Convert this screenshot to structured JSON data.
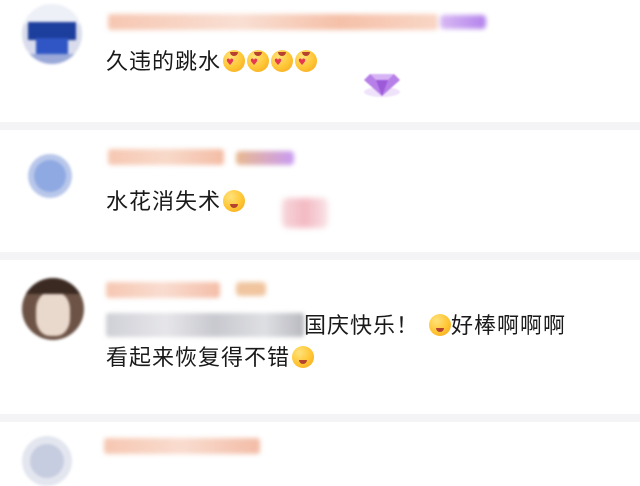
{
  "comments": [
    {
      "text_parts": [
        {
          "kind": "text",
          "value": "久违的跳水"
        },
        {
          "kind": "emoji",
          "icon": "heart-eyes-emoji"
        },
        {
          "kind": "emoji",
          "icon": "heart-eyes-emoji"
        },
        {
          "kind": "emoji",
          "icon": "heart-eyes-emoji"
        },
        {
          "kind": "emoji",
          "icon": "heart-eyes-emoji"
        }
      ],
      "decoration_icon": "purple-gem-icon"
    },
    {
      "text_parts": [
        {
          "kind": "text",
          "value": "水花消失术"
        },
        {
          "kind": "emoji",
          "icon": "laughing-emoji"
        }
      ]
    },
    {
      "line1_text": "国庆快乐！",
      "line1_suffix": "好棒啊啊啊",
      "line2_text": "看起来恢复得不错",
      "emoji_icons": [
        "kissing-emoji",
        "pleading-emoji"
      ]
    }
  ],
  "colors": {
    "divider": "#f4f4f6",
    "name_blur": "#f7c9b6",
    "badge_blur": "#c79cf0",
    "text": "#1a1a1a",
    "emoji_yellow": "#ffc533"
  }
}
